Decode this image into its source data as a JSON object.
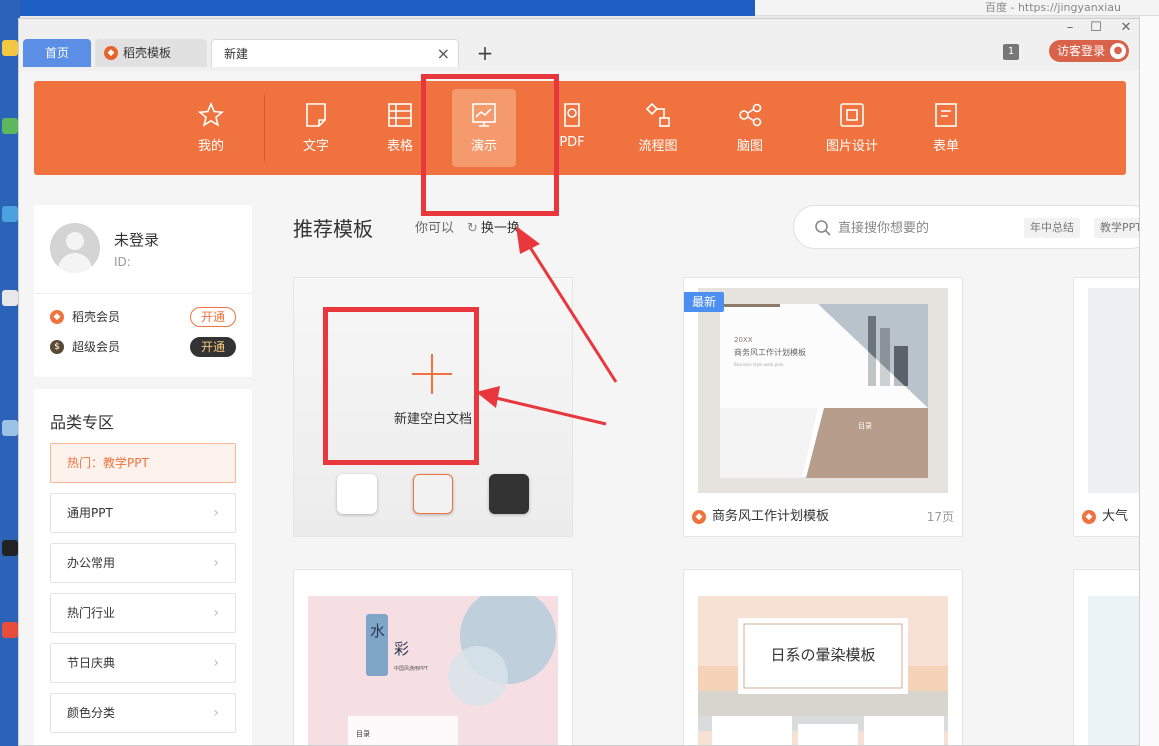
{
  "browser": {
    "url_fragment": "百度 - https://jingyanxiau"
  },
  "tabs": [
    {
      "label": "首页"
    },
    {
      "label": "稻壳模板"
    },
    {
      "label": "新建"
    }
  ],
  "titlebar": {
    "count_badge": "1",
    "login_label": "访客登录"
  },
  "toolbar": {
    "items": [
      {
        "label": "我的",
        "icon": "star-icon"
      },
      {
        "label": "文字",
        "icon": "document-icon"
      },
      {
        "label": "表格",
        "icon": "table-icon"
      },
      {
        "label": "演示",
        "icon": "presentation-icon",
        "active": true
      },
      {
        "label": "PDF",
        "icon": "pdf-icon"
      },
      {
        "label": "流程图",
        "icon": "flowchart-icon"
      },
      {
        "label": "脑图",
        "icon": "mindmap-icon"
      },
      {
        "label": "图片设计",
        "icon": "image-design-icon"
      },
      {
        "label": "表单",
        "icon": "form-icon"
      }
    ]
  },
  "user": {
    "name": "未登录",
    "id_label": "ID:",
    "memberships": [
      {
        "label": "稻壳会员",
        "action": "开通"
      },
      {
        "label": "超级会员",
        "action": "开通"
      }
    ]
  },
  "categories": {
    "title": "品类专区",
    "items": [
      "热门：教学PPT",
      "通用PPT",
      "办公常用",
      "热门行业",
      "节日庆典",
      "颜色分类"
    ]
  },
  "main": {
    "title": "推荐模板",
    "hint": "你可以",
    "refresh_label": "换一换",
    "search_placeholder": "直接搜你想要的",
    "search_tags": [
      "年中总结",
      "教学PPT"
    ]
  },
  "blank_card": {
    "label": "新建空白文档",
    "swatches": [
      "#ffffff",
      "#f2f2f2",
      "#333333"
    ]
  },
  "templates": [
    {
      "badge": "最新",
      "name": "商务风工作计划模板",
      "pages": "17页",
      "thumb_text": [
        "20XX",
        "商务风工作计划模板",
        "Business style work plan",
        "目录"
      ]
    },
    {
      "name": "大气"
    },
    {
      "thumb_text": [
        "水",
        "彩",
        "中国风通用PPT",
        "目录"
      ]
    },
    {
      "thumb_text": [
        "日系の暈染模板"
      ]
    }
  ],
  "colors": {
    "accent": "#f0733f",
    "annotation": "#e8383d",
    "tab_blue": "#5b8fe5"
  }
}
